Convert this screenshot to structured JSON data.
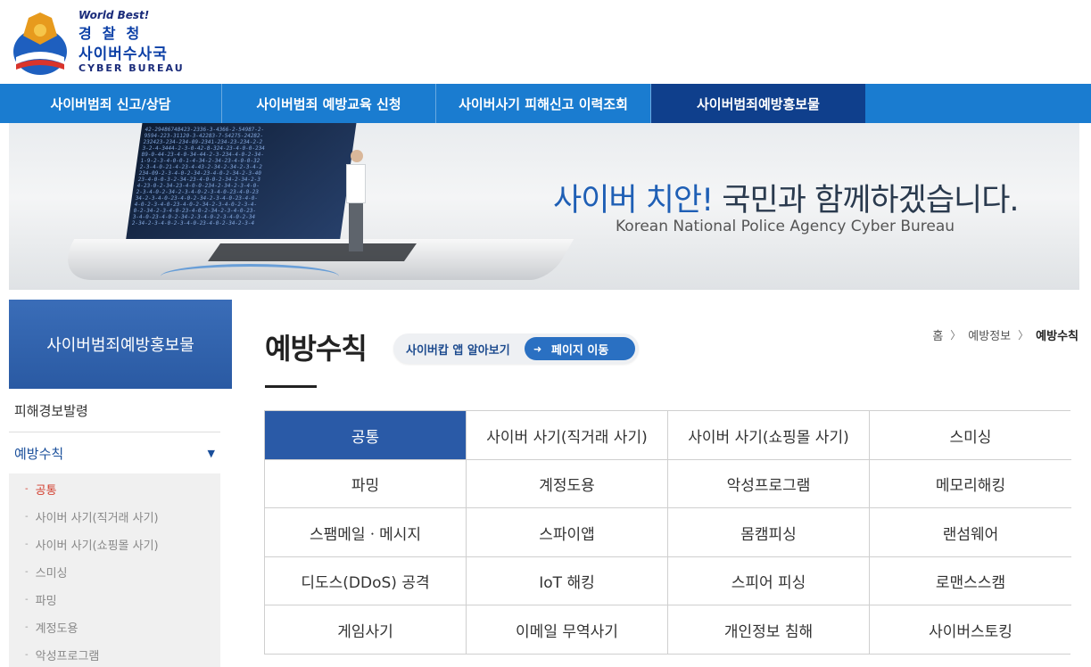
{
  "logo": {
    "worldbest": "World Best!",
    "police": "경찰청",
    "cyber_bureau_kr": "사이버수사국",
    "cyber_bureau_en": "CYBER BUREAU"
  },
  "gnb": {
    "items": [
      {
        "label": "사이버범죄 신고/상담"
      },
      {
        "label": "사이버범죄 예방교육 신청"
      },
      {
        "label": "사이버사기 피해신고 이력조회"
      },
      {
        "label": "사이버범죄예방홍보물"
      }
    ],
    "active_index": 3
  },
  "banner": {
    "title_blue": "사이버 치안!",
    "title_rest": " 국민과 함께하겠습니다.",
    "subtitle": "Korean National Police Agency Cyber Bureau"
  },
  "sidebar": {
    "heading": "사이버범죄예방홍보물",
    "menu1": "피해경보발령",
    "menu2": "예방수칙",
    "subitems": [
      "공통",
      "사이버 사기(직거래 사기)",
      "사이버 사기(쇼핑몰 사기)",
      "스미싱",
      "파밍",
      "계정도용",
      "악성프로그램"
    ]
  },
  "content": {
    "title": "예방수칙",
    "app_label": "사이버캅 앱 알아보기",
    "app_button": "페이지 이동"
  },
  "breadcrumb": {
    "home": "홈",
    "level1": "예방정보",
    "current": "예방수칙"
  },
  "grid": {
    "cells": [
      "공통",
      "사이버 사기(직거래 사기)",
      "사이버 사기(쇼핑몰 사기)",
      "스미싱",
      "파밍",
      "계정도용",
      "악성프로그램",
      "메모리해킹",
      "스팸메일ㆍ메시지",
      "스파이앱",
      "몸캠피싱",
      "랜섬웨어",
      "디도스(DDoS) 공격",
      "IoT 해킹",
      "스피어 피싱",
      "로맨스스캠",
      "게임사기",
      "이메일 무역사기",
      "개인정보 침해",
      "사이버스토킹"
    ],
    "active_index": 0
  },
  "colors": {
    "gnb": "#1a7cd0",
    "gnb_active": "#0f3f8c",
    "grid_active": "#2a5aa7",
    "sidebar_active": "#d23b2b"
  }
}
